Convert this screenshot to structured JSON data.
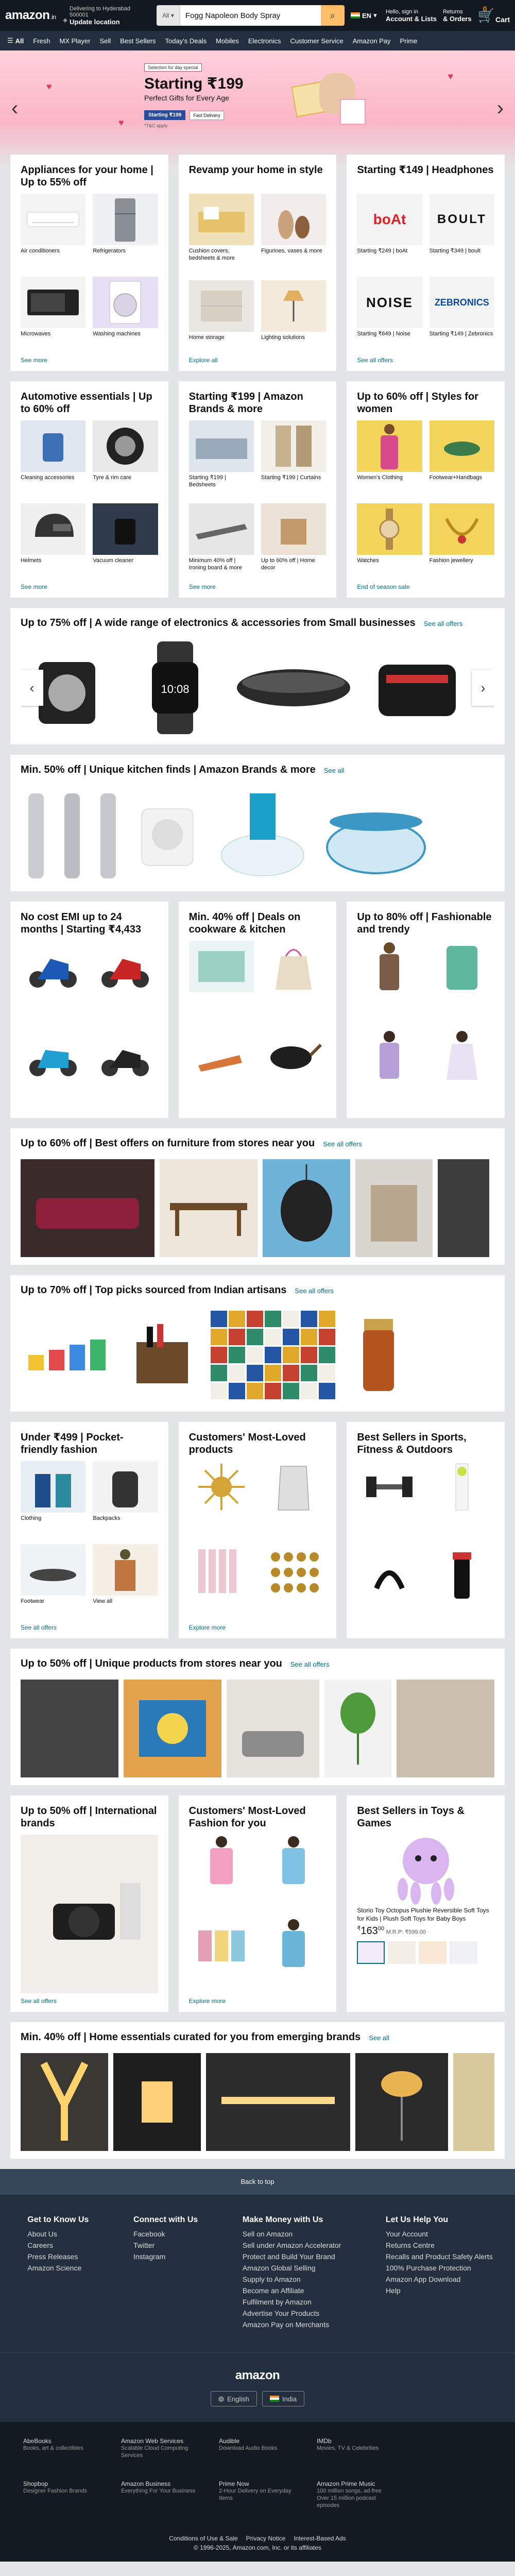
{
  "header": {
    "logo": "amazon",
    "logo_suffix": ".in",
    "location_line1": "Delivering to Hyderabad 500001",
    "location_line2": "Update location",
    "search_category": "All",
    "search_value": "Fogg Napoleon Body Spray",
    "lang": "EN",
    "account_line1": "Hello, sign in",
    "account_line2": "Account & Lists",
    "orders_line1": "Returns",
    "orders_line2": "& Orders",
    "cart_count": "0",
    "cart_label": "Cart"
  },
  "subnav": {
    "all": "All",
    "items": [
      "Fresh",
      "MX Player",
      "Sell",
      "Best Sellers",
      "Today's Deals",
      "Mobiles",
      "Electronics",
      "Customer Service",
      "Amazon Pay",
      "Prime"
    ]
  },
  "hero": {
    "tag": "Selection for day special",
    "headline": "Starting ₹199",
    "subhead": "Perfect Gifts for Every Age",
    "bank1": "Starting ₹199",
    "bank2": "Fast Delivery",
    "tc": "*T&C apply"
  },
  "cards_row1": [
    {
      "title": "Appliances for your home | Up to 55% off",
      "items": [
        "Air conditioners",
        "Refrigerators",
        "Microwaves",
        "Washing machines"
      ],
      "more": "See more"
    },
    {
      "title": "Revamp your home in style",
      "items": [
        "Cushion covers, bedsheets & more",
        "Figurines, vases & more",
        "Home storage",
        "Lighting solutions"
      ],
      "more": "Explore all"
    },
    {
      "title": "Starting ₹149 | Headphones",
      "items": [
        "Starting ₹249 | boAt",
        "Starting ₹349 | boult",
        "Starting ₹649 | Noise",
        "Starting ₹149 | Zebronics"
      ],
      "brands": [
        "boAt",
        "BOULT",
        "NOISE",
        "ZEBRONICS"
      ],
      "more": "See all offers"
    }
  ],
  "cards_row2": [
    {
      "title": "Automotive essentials | Up to 60% off",
      "items": [
        "Cleaning accessories",
        "Tyre & rim care",
        "Helmets",
        "Vacuum cleaner"
      ],
      "more": "See more"
    },
    {
      "title": "Starting ₹199 | Amazon Brands & more",
      "items": [
        "Starting ₹199 | Bedsheets",
        "Starting ₹199 | Curtains",
        "Minimum 40% off | Ironing board & more",
        "Up to 60% off | Home decor"
      ],
      "more": "See more"
    },
    {
      "title": "Up to 60% off | Styles for women",
      "items": [
        "Women's Clothing",
        "Footwear+Handbags",
        "Watches",
        "Fashion jewellery"
      ],
      "more": "End of season sale"
    }
  ],
  "strip_electronics": {
    "title": "Up to 75% off | A wide range of electronics & accessories from Small businesses",
    "see": "See all offers"
  },
  "strip_kitchen": {
    "title": "Min. 50% off | Unique kitchen finds | Amazon Brands & more",
    "see": "See all"
  },
  "cards_row3": [
    {
      "title": "No cost EMI up to 24 months | Starting ₹4,433"
    },
    {
      "title": "Min. 40% off | Deals on cookware & kitchen"
    },
    {
      "title": "Up to 80% off | Fashionable and trendy"
    }
  ],
  "strip_furniture": {
    "title": "Up to 60% off | Best offers on furniture from stores near you",
    "see": "See all offers"
  },
  "strip_artisans": {
    "title": "Up to 70% off | Top picks sourced from Indian artisans",
    "see": "See all offers"
  },
  "cards_row4": [
    {
      "title": "Under ₹499 | Pocket-friendly fashion",
      "items": [
        "Clothing",
        "Backpacks",
        "Footwear",
        "View all"
      ],
      "more": "See all offers"
    },
    {
      "title": "Customers' Most-Loved products",
      "items": [
        "",
        "",
        "",
        ""
      ],
      "more": "Explore more"
    },
    {
      "title": "Best Sellers in Sports, Fitness & Outdoors",
      "items": [
        "",
        "",
        "",
        ""
      ],
      "more": ""
    }
  ],
  "strip_unique": {
    "title": "Up to 50% off | Unique products from stores near you",
    "see": "See all offers"
  },
  "cards_row5": [
    {
      "title": "Up to 50% off | International brands",
      "more": "See all offers"
    },
    {
      "title": "Customers' Most-Loved Fashion for you",
      "more": "Explore more"
    },
    {
      "title": "Best Sellers in Toys & Games",
      "product": "Storio Toy Octopus Plushie Reversible Soft Toys for Kids | Plush Soft Toys for Baby Boys",
      "price": "163",
      "mrp": "M.R.P: ₹599.00"
    }
  ],
  "strip_home": {
    "title": "Min. 40% off | Home essentials curated for you from emerging brands",
    "see": "See all"
  },
  "footer": {
    "back_to_top": "Back to top",
    "cols": [
      {
        "title": "Get to Know Us",
        "links": [
          "About Us",
          "Careers",
          "Press Releases",
          "Amazon Science"
        ]
      },
      {
        "title": "Connect with Us",
        "links": [
          "Facebook",
          "Twitter",
          "Instagram"
        ]
      },
      {
        "title": "Make Money with Us",
        "links": [
          "Sell on Amazon",
          "Sell under Amazon Accelerator",
          "Protect and Build Your Brand",
          "Amazon Global Selling",
          "Supply to Amazon",
          "Become an Affiliate",
          "Fulfilment by Amazon",
          "Advertise Your Products",
          "Amazon Pay on Merchants"
        ]
      },
      {
        "title": "Let Us Help You",
        "links": [
          "Your Account",
          "Returns Centre",
          "Recalls and Product Safety Alerts",
          "100% Purchase Protection",
          "Amazon App Download",
          "Help"
        ]
      }
    ],
    "lang_btn": "English",
    "country_btn": "India",
    "low": [
      {
        "t": "AbeBooks",
        "d": "Books, art & collectibles"
      },
      {
        "t": "Amazon Web Services",
        "d": "Scalable Cloud Computing Services"
      },
      {
        "t": "Audible",
        "d": "Download Audio Books"
      },
      {
        "t": "IMDb",
        "d": "Movies, TV & Celebrities"
      },
      {
        "t": "Shopbop",
        "d": "Designer Fashion Brands"
      },
      {
        "t": "Amazon Business",
        "d": "Everything For Your Business"
      },
      {
        "t": "Prime Now",
        "d": "2-Hour Delivery on Everyday Items"
      },
      {
        "t": "Amazon Prime Music",
        "d": "100 million songs, ad-free Over 15 million podcast episodes"
      }
    ],
    "legal_links": [
      "Conditions of Use & Sale",
      "Privacy Notice",
      "Interest-Based Ads"
    ],
    "copyright": "© 1996-2025, Amazon.com, Inc. or its affiliates"
  }
}
